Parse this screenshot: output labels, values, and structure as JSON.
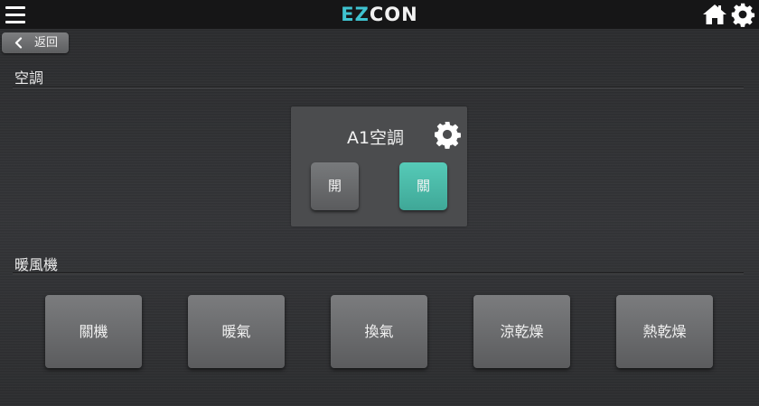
{
  "header": {
    "logo_accent": "EZ",
    "logo_rest": "CON",
    "accent_color": "#3fc3d0"
  },
  "nav": {
    "back_label": "返回",
    "icons": [
      "menu-icon",
      "home-icon",
      "gear-icon",
      "chevron-left-icon"
    ]
  },
  "sections": {
    "air_conditioner": {
      "title": "空調",
      "device": {
        "name": "A1空調",
        "on_label": "開",
        "off_label": "關",
        "active_state": "off",
        "active_color": "#4bbaa8"
      }
    },
    "heater": {
      "title": "暖風機",
      "modes": [
        "關機",
        "暖氣",
        "換氣",
        "涼乾燥",
        "熱乾燥"
      ]
    }
  }
}
